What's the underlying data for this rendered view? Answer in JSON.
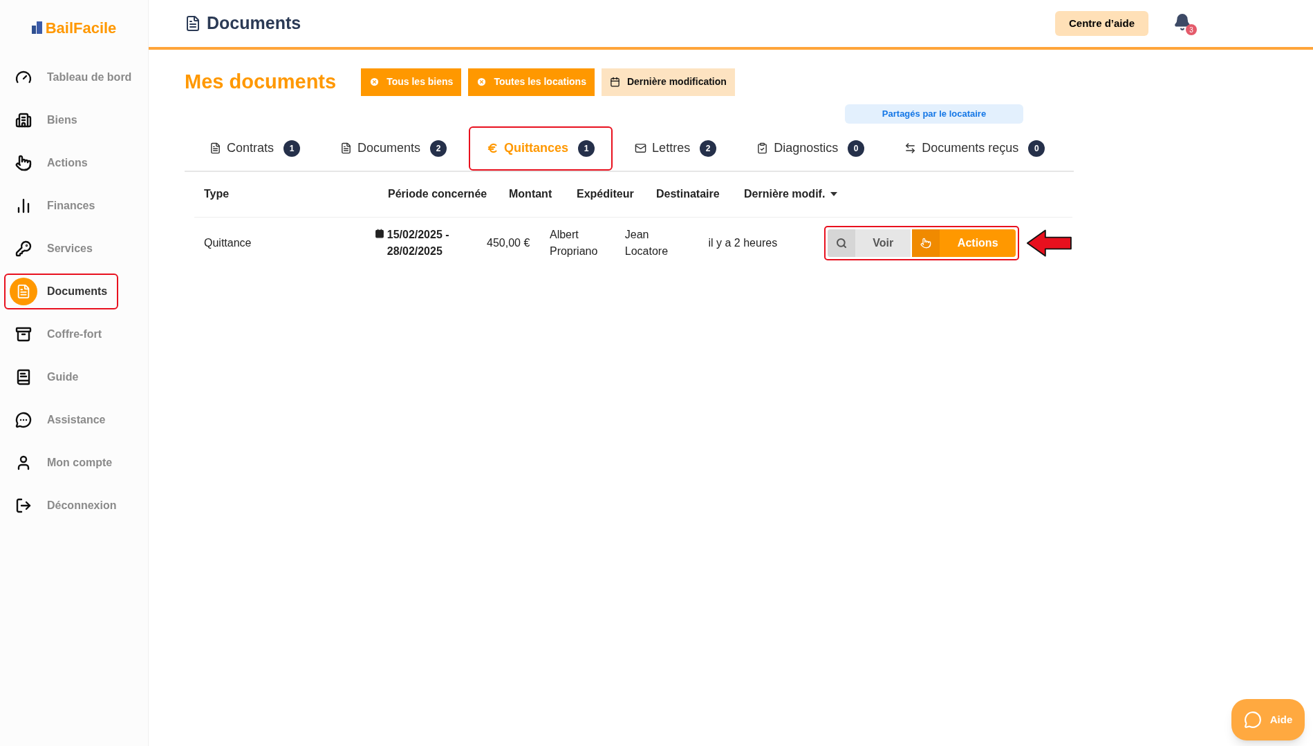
{
  "sidebar": {
    "logo": "BailFacile",
    "items": [
      {
        "label": "Tableau de bord",
        "selected": false,
        "highlighted": false
      },
      {
        "label": "Biens",
        "selected": false,
        "highlighted": false
      },
      {
        "label": "Actions",
        "selected": false,
        "highlighted": false
      },
      {
        "label": "Finances",
        "selected": false,
        "highlighted": false
      },
      {
        "label": "Services",
        "selected": false,
        "highlighted": false
      },
      {
        "label": "Documents",
        "selected": true,
        "highlighted": true
      },
      {
        "label": "Coffre-fort",
        "selected": false,
        "highlighted": false
      },
      {
        "label": "Guide",
        "selected": false,
        "highlighted": false
      },
      {
        "label": "Assistance",
        "selected": false,
        "highlighted": false
      },
      {
        "label": "Mon compte",
        "selected": false,
        "highlighted": false
      },
      {
        "label": "Déconnexion",
        "selected": false,
        "highlighted": false
      }
    ]
  },
  "header": {
    "title": "Documents",
    "help_button": "Centre d’aide",
    "notifications": "3"
  },
  "page": {
    "title": "Mes documents",
    "filters": [
      {
        "label": "Tous les biens",
        "kind": "clear"
      },
      {
        "label": "Toutes les locations",
        "kind": "clear"
      },
      {
        "label": "Dernière modification",
        "kind": "date"
      }
    ],
    "shared_note": "Partagés par le locataire"
  },
  "tabs": [
    {
      "label": "Contrats",
      "count": "1",
      "selected": false,
      "highlighted": false
    },
    {
      "label": "Documents",
      "count": "2",
      "selected": false,
      "highlighted": false
    },
    {
      "label": "Quittances",
      "count": "1",
      "selected": true,
      "highlighted": true
    },
    {
      "label": "Lettres",
      "count": "2",
      "selected": false,
      "highlighted": false
    },
    {
      "label": "Diagnostics",
      "count": "0",
      "selected": false,
      "highlighted": false
    },
    {
      "label": "Documents reçus",
      "count": "0",
      "selected": false,
      "highlighted": false
    }
  ],
  "table": {
    "columns": [
      {
        "label": "Type",
        "sorted": false
      },
      {
        "label": "Période concernée",
        "sorted": false
      },
      {
        "label": "Montant",
        "sorted": false
      },
      {
        "label": "Expéditeur",
        "sorted": false
      },
      {
        "label": "Destinataire",
        "sorted": false
      },
      {
        "label": "Dernière modif.",
        "sorted": true
      }
    ],
    "rows": [
      {
        "type": "Quittance",
        "period": "15/02/2025 - 28/02/2025",
        "amount": "450,00 €",
        "sender": "Albert Propriano",
        "recipient": "Jean Locatore",
        "modified": "il y a 2 heures",
        "view_button": "Voir",
        "actions_button": "Actions",
        "highlighted": true,
        "arrow": true
      }
    ]
  },
  "help_widget": "Aide"
}
